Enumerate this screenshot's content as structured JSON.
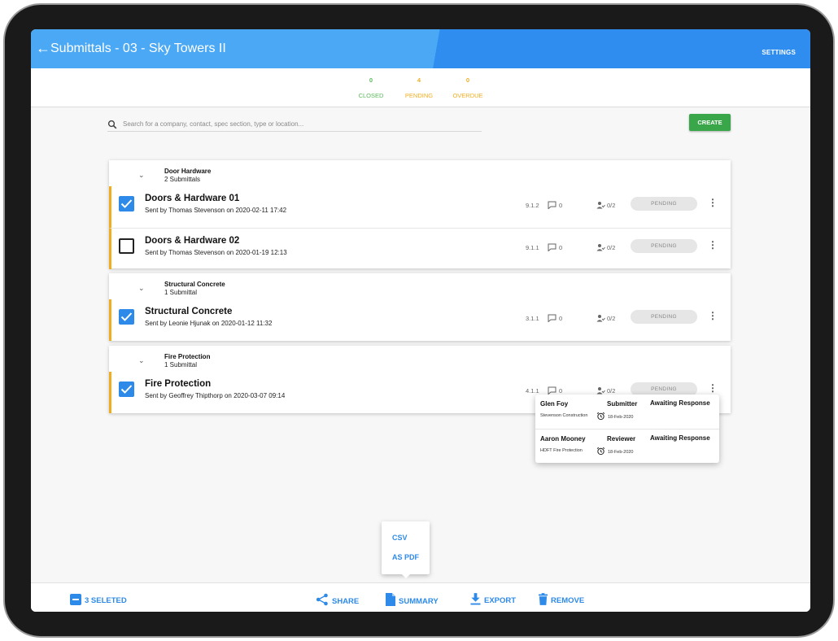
{
  "header": {
    "title": "Submittals - 03 - Sky Towers II",
    "settings_label": "SETTINGS"
  },
  "stats": [
    {
      "value": "0",
      "label": "CLOSED",
      "color": "#5cb85c"
    },
    {
      "value": "4",
      "label": "PENDING",
      "color": "#f0ad1f"
    },
    {
      "value": "0",
      "label": "OVERDUE",
      "color": "#f0ad1f"
    }
  ],
  "search": {
    "placeholder": "Search for a company, contact, spec section, type or location..."
  },
  "create_label": "CREATE",
  "groups": [
    {
      "name": "Door Hardware",
      "count": "2 Submittals",
      "rows": [
        {
          "title": "Doors & Hardware 01",
          "subtitle": "Sent by Thomas Stevenson on 2020-02-11 17:42",
          "checked": true,
          "spec": "9.1.2",
          "comments": "0",
          "reviewers": "0/2",
          "status": "PENDING"
        },
        {
          "title": "Doors & Hardware 02",
          "subtitle": "Sent by Thomas Stevenson on 2020-01-19 12:13",
          "checked": false,
          "spec": "9.1.1",
          "comments": "0",
          "reviewers": "0/2",
          "status": "PENDING"
        }
      ]
    },
    {
      "name": "Structural Concrete",
      "count": "1 Submittal",
      "rows": [
        {
          "title": "Structural Concrete",
          "subtitle": "Sent by Leonie Hjunak on 2020-01-12 11:32",
          "checked": true,
          "spec": "3.1.1",
          "comments": "0",
          "reviewers": "0/2",
          "status": "PENDING"
        }
      ]
    },
    {
      "name": "Fire Protection",
      "count": "1 Submittal",
      "rows": [
        {
          "title": "Fire Protection",
          "subtitle": "Sent by Geoffrey Thipthorp on 2020-03-07 09:14",
          "checked": true,
          "spec": "4.1.1",
          "comments": "0",
          "reviewers": "0/2",
          "status": "PENDING"
        }
      ]
    }
  ],
  "reviewers_popover": [
    {
      "name": "Glen Foy",
      "role": "Submitter",
      "status": "Awaiting Response",
      "company": "Stevenson Construction",
      "date": "18-Feb-2020"
    },
    {
      "name": "Aaron Mooney",
      "role": "Reviewer",
      "status": "Awaiting Response",
      "company": "HDFT Fire Protection",
      "date": "18-Feb-2020"
    }
  ],
  "summary_menu": [
    "CSV",
    "AS PDF"
  ],
  "bottom_bar": {
    "selected_label": "3 SELETED",
    "share": "SHARE",
    "summary": "SUMMARY",
    "export": "EXPORT",
    "remove": "REMOVE"
  },
  "colors": {
    "accent": "#2d8ae8",
    "header": "#4aa8f5",
    "create": "#39a64a",
    "row_marker": "#f0ad1f"
  }
}
